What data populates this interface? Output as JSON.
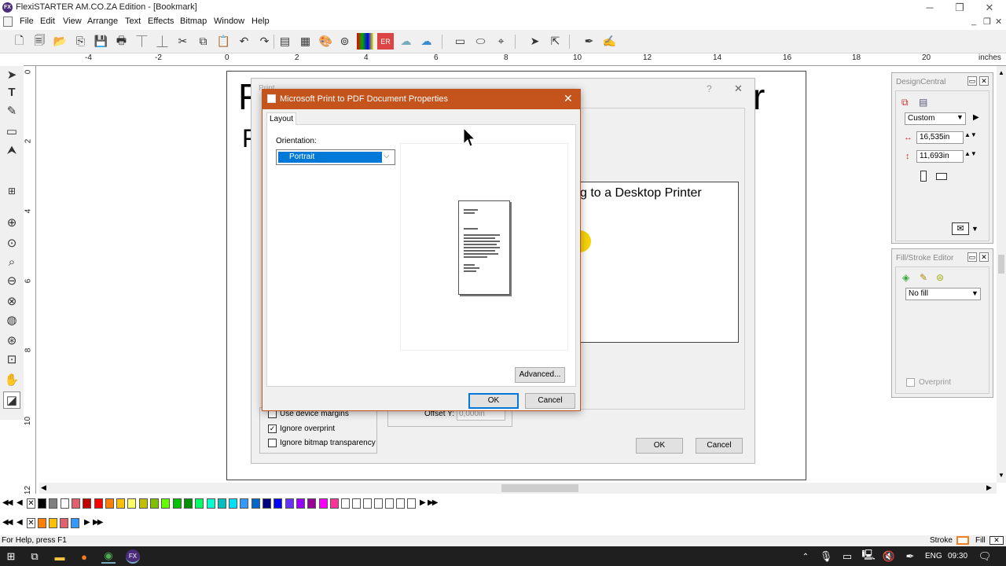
{
  "app": {
    "title": "FlexiSTARTER AM.CO.ZA Edition - [Bookmark]",
    "icon_label": "FX"
  },
  "window_controls": {
    "minimize": "─",
    "maximize": "❐",
    "close": "✕"
  },
  "mdi_controls": {
    "minimize": "_",
    "restore": "❐",
    "close": "✕"
  },
  "menu": [
    "File",
    "Edit",
    "View",
    "Arrange",
    "Text",
    "Effects",
    "Bitmap",
    "Window",
    "Help"
  ],
  "ruler": {
    "unit": "inches",
    "h_ticks": [
      "-4",
      "-2",
      "0",
      "2",
      "4",
      "6",
      "8",
      "10",
      "12",
      "14",
      "16",
      "18",
      "20"
    ],
    "v_ticks": [
      "0",
      "2",
      "4",
      "6",
      "8",
      "10",
      "12"
    ]
  },
  "document": {
    "big_title_left": "F",
    "big_title_right": "r",
    "subtitle_left": "F",
    "preview_text": "g to a Desktop Printer"
  },
  "print_dialog": {
    "title": "Print",
    "help_glyph": "?",
    "close_glyph": "✕",
    "options": [
      {
        "label": "Use device margins",
        "checked": false
      },
      {
        "label": "Ignore overprint",
        "checked": true
      },
      {
        "label": "Ignore bitmap transparency",
        "checked": false
      }
    ],
    "offset_y_label": "Offset Y:",
    "offset_y_value": "0,000in",
    "ok": "OK",
    "cancel": "Cancel"
  },
  "props_dialog": {
    "title": "Microsoft Print to PDF Document Properties",
    "close_glyph": "✕",
    "tab": "Layout",
    "orientation_label": "Orientation:",
    "orientation_value": "Portrait",
    "advanced": "Advanced...",
    "ok": "OK",
    "cancel": "Cancel"
  },
  "design_central": {
    "title": "DesignCentral",
    "preset": "Custom",
    "width": "16,535in",
    "height": "11,693in"
  },
  "fill_stroke": {
    "title": "Fill/Stroke Editor",
    "fill": "No fill",
    "overprint": "Overprint"
  },
  "palette": {
    "colors": [
      "#000000",
      "#808080",
      "#ffffff",
      "#e06070",
      "#c00000",
      "#ff0000",
      "#ff8000",
      "#ffc000",
      "#ffff66",
      "#c0c000",
      "#80c000",
      "#66ff00",
      "#00c000",
      "#009000",
      "#00ff66",
      "#00ffcc",
      "#00c0c0",
      "#00e0ff",
      "#3399ff",
      "#0066cc",
      "#000080",
      "#0000ff",
      "#6633ff",
      "#9900ff",
      "#990099",
      "#ff00ff",
      "#ff3399"
    ],
    "recent": [
      "#ff8000",
      "#ffc000",
      "#e06070",
      "#3399ff"
    ]
  },
  "status": {
    "help": "For Help, press F1",
    "stroke": "Stroke",
    "fill": "Fill"
  },
  "taskbar": {
    "lang": "ENG",
    "time": "09:30"
  }
}
